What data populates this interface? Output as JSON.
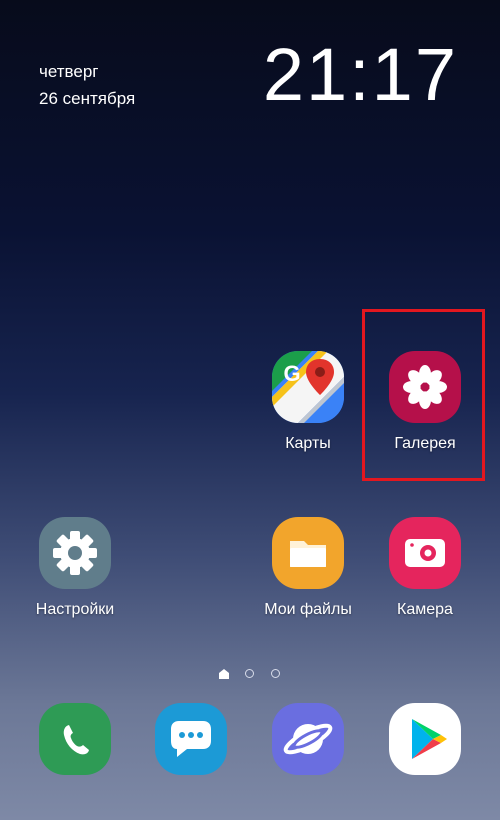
{
  "lockscreen": {
    "day": "четверг",
    "date": "26 сентября",
    "time": "21:17"
  },
  "apps": {
    "maps": {
      "label": "Карты",
      "icon": "google-maps-icon"
    },
    "gallery": {
      "label": "Галерея",
      "icon": "flower-icon",
      "color": "#b5104a"
    },
    "settings": {
      "label": "Настройки",
      "icon": "gear-icon",
      "color": "#607d8b"
    },
    "files": {
      "label": "Мои файлы",
      "icon": "folder-icon",
      "color": "#f2a52c"
    },
    "camera": {
      "label": "Камера",
      "icon": "camera-icon",
      "color": "#e5255d"
    }
  },
  "dock": {
    "phone": {
      "icon": "phone-icon",
      "color": "#2e9b55"
    },
    "messages": {
      "icon": "chat-bubble-icon",
      "color": "#1c9ad6"
    },
    "internet": {
      "icon": "planet-icon",
      "color": "#6a6ee0"
    },
    "play_store": {
      "icon": "play-store-icon",
      "color": "#ffffff"
    }
  },
  "page_indicator": {
    "pages": 3,
    "current": 0
  },
  "colors": {
    "highlight": "#e3171f"
  }
}
